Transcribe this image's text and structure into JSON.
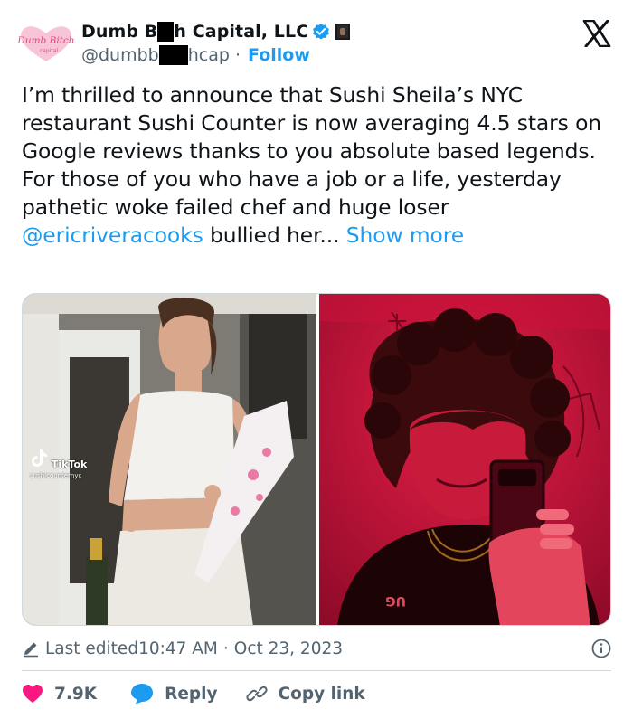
{
  "author": {
    "display_name_start": "Dumb B",
    "display_name_end": "h Capital, LLC",
    "handle_start": "@dumbb",
    "handle_end": "hcap",
    "separator": "·",
    "follow_label": "Follow",
    "avatar_text": "Dumb Bitch",
    "avatar_subtext": "capital",
    "avatar_colors": {
      "heart": "#f8c4d8",
      "script": "#e0457a"
    }
  },
  "tweet": {
    "text_before_mention": "I’m thrilled to announce that Sushi Sheila’s NYC restaurant Sushi Counter is now averaging 4.5 stars on Google reviews thanks to you absolute based legends. For those of you who have a job or a life, yesterday pathetic woke failed chef and huge loser ",
    "mention": "@ericriveracooks",
    "text_after_mention": " bullied her...",
    "show_more": "Show more"
  },
  "media": {
    "left": {
      "watermark_brand": "TikTok",
      "watermark_handle": "sushicounternyc",
      "icon": "tiktok-icon"
    },
    "right": {
      "icon": "photo",
      "accent": "#e0163c"
    }
  },
  "meta": {
    "edited_label": "Last edited",
    "time": "10:47 AM",
    "separator": "·",
    "date": "Oct 23, 2023"
  },
  "actions": {
    "like_count": "7.9K",
    "reply_label": "Reply",
    "copy_link_label": "Copy link"
  },
  "colors": {
    "accent": "#1d9bf0",
    "like": "#f91880",
    "text": "#0f1419",
    "secondary": "#536471"
  }
}
